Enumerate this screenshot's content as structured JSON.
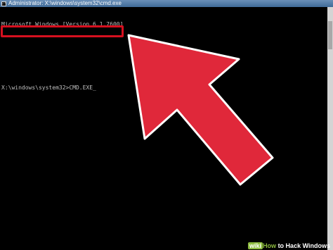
{
  "window": {
    "title": "Administrator: X:\\windows\\system32\\cmd.exe",
    "icon_label": "C:\\",
    "icon": "console-icon"
  },
  "console": {
    "lines": [
      "Microsoft Windows [Version 6.1.7600]",
      "",
      "",
      "X:\\windows\\system32>CMD.EXE"
    ],
    "cursor": "_",
    "text_color": "#c0c0c0",
    "background": "#000000"
  },
  "annotation": {
    "highlight_color": "#d6101f",
    "arrow_fill": "#e0283a",
    "arrow_icon": "red-arrow-pointing-up-left"
  },
  "watermark": {
    "logo": "wiki",
    "how": "How",
    "rest": " to Hack Windows"
  }
}
